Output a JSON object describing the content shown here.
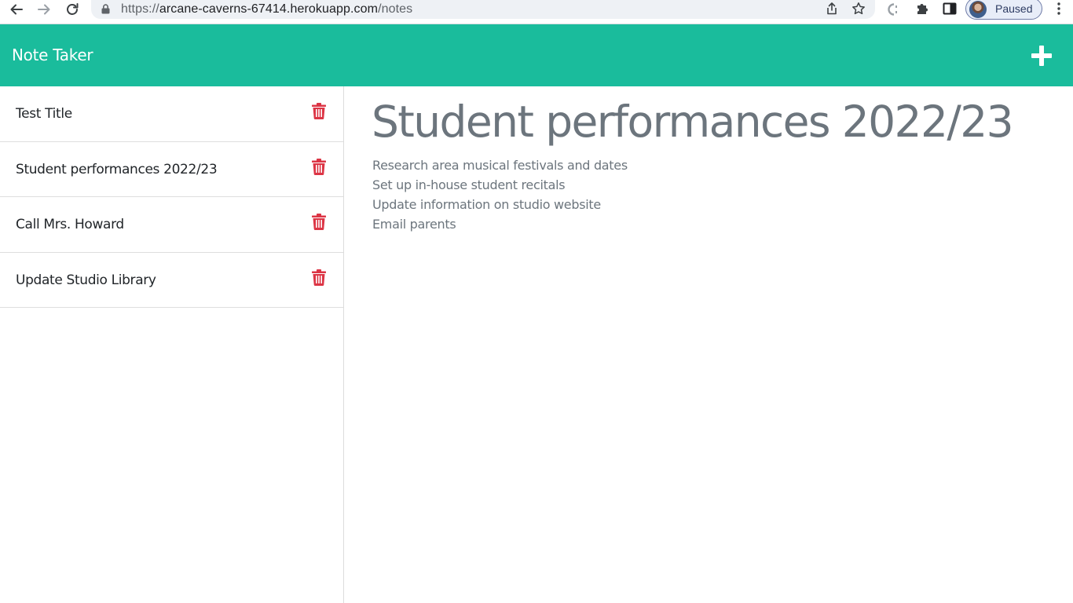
{
  "browser": {
    "url_scheme": "https://",
    "url_host": "arcane-caverns-67414.herokuapp.com",
    "url_path": "/notes",
    "profile_status": "Paused"
  },
  "header": {
    "brand": "Note Taker",
    "add_icon": "plus-icon"
  },
  "notes": [
    {
      "title": "Test Title",
      "delete_icon": "trash-icon"
    },
    {
      "title": "Student performances 2022/23",
      "delete_icon": "trash-icon"
    },
    {
      "title": "Call Mrs. Howard",
      "delete_icon": "trash-icon"
    },
    {
      "title": "Update Studio Library",
      "delete_icon": "trash-icon"
    }
  ],
  "active_note": {
    "title": "Student performances 2022/23",
    "lines": [
      "Research area musical festivals and dates",
      "Set up in-house student recitals",
      "Update information on studio website",
      "Email parents"
    ]
  },
  "colors": {
    "header_bg": "#1abc9c",
    "delete_icon": "#dc3545",
    "note_text": "#6c757d"
  }
}
